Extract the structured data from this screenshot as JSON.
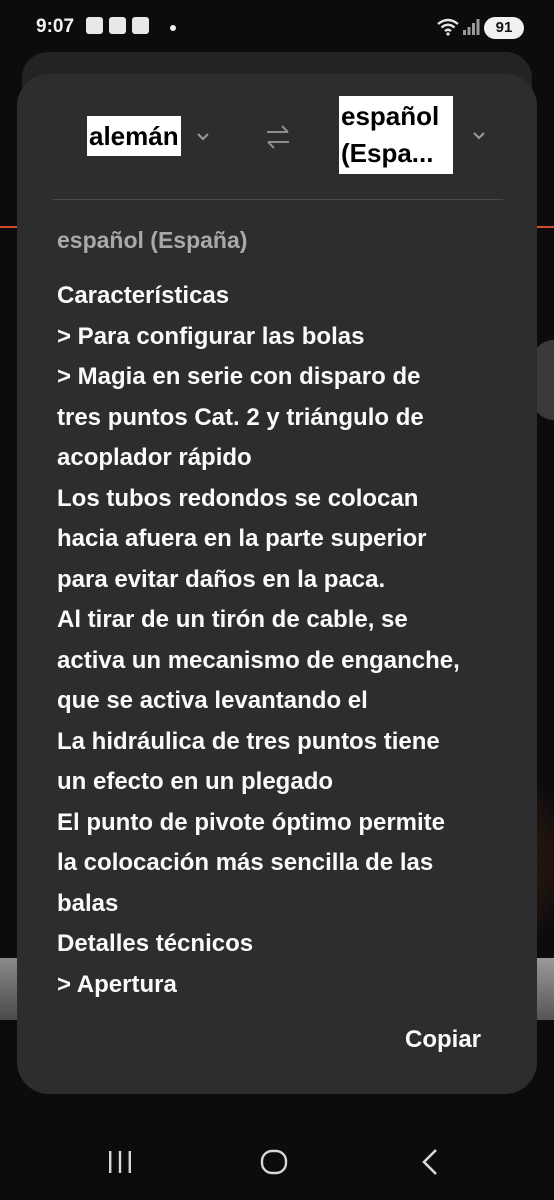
{
  "status_bar": {
    "time": "9:07",
    "battery": "91"
  },
  "translator": {
    "source_language": "alemán",
    "target_language": "español (Espa...",
    "detected_language": "español (España)",
    "result_lines": [
      "Características",
      "> Para configurar las bolas",
      "> Magia en serie con disparo de",
      "tres puntos Cat. 2 y triángulo de",
      "acoplador rápido",
      "Los tubos redondos se colocan",
      "hacia afuera en la parte superior",
      "para evitar daños en la paca.",
      "Al tirar de un tirón de cable, se",
      "activa un mecanismo de enganche,",
      "que se activa levantando el",
      "La hidráulica de tres puntos tiene",
      "un efecto en un plegado",
      "El punto de pivote óptimo permite",
      "la colocación más sencilla de las",
      "balas",
      "Detalles técnicos",
      "> Apertura"
    ],
    "copy_label": "Copiar"
  },
  "icons": {
    "swap": "swap-arrows-icon",
    "chevron": "chevron-down-icon",
    "recent": "recent-apps-icon",
    "home": "home-icon",
    "back": "back-icon"
  }
}
